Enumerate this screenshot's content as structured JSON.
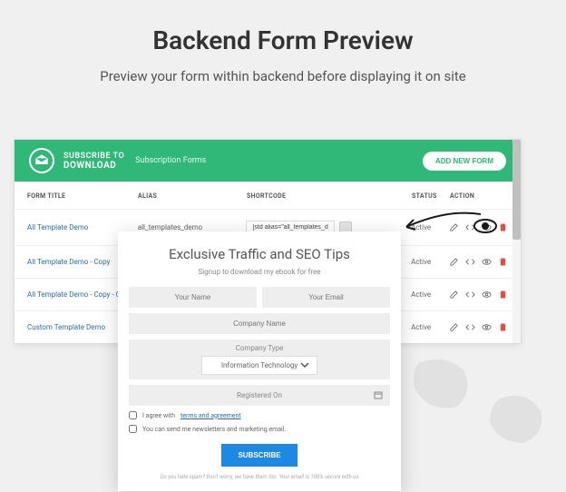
{
  "page": {
    "title": "Backend Form Preview",
    "subtitle": "Preview your form within backend before displaying it on site"
  },
  "app": {
    "brand_line1": "SUBSCRIBE TO",
    "brand_line2": "DOWNLOAD",
    "section_label": "Subscription Forms",
    "add_button": "ADD NEW FORM"
  },
  "table": {
    "headers": {
      "title": "FORM TITLE",
      "alias": "ALIAS",
      "shortcode": "SHORTCODE",
      "status": "STATUS",
      "action": "ACTION"
    },
    "rows": [
      {
        "title": "All Template Demo",
        "alias": "all_templates_demo",
        "shortcode": "[std alias=\"all_templates_demo\"]",
        "status": "Active"
      },
      {
        "title": "All Template Demo - Copy",
        "alias": "",
        "shortcode": "",
        "status": "Active"
      },
      {
        "title": "All Template Demo - Copy - Copy",
        "alias": "",
        "shortcode": "",
        "status": "Active"
      },
      {
        "title": "Custom Template Demo",
        "alias": "",
        "shortcode": "",
        "status": "Active"
      }
    ]
  },
  "modal": {
    "title": "Exclusive Traffic and SEO Tips",
    "subtitle": "Signup to download my ebook for free",
    "name_placeholder": "Your Name",
    "email_placeholder": "Your Email",
    "company_name_placeholder": "Company Name",
    "company_type_label": "Company Type",
    "company_type_value": "Information Technology",
    "registered_on_placeholder": "Registered On",
    "agree_prefix": "I agree with",
    "agree_link": "terms and agreement",
    "newsletter_text": "You can send me newsletters and marketing email.",
    "subscribe_button": "SUBSCRIBE",
    "footer_text": "Do you hate spam? Don't worry, we have them too. Your email is 100% secure with us"
  }
}
